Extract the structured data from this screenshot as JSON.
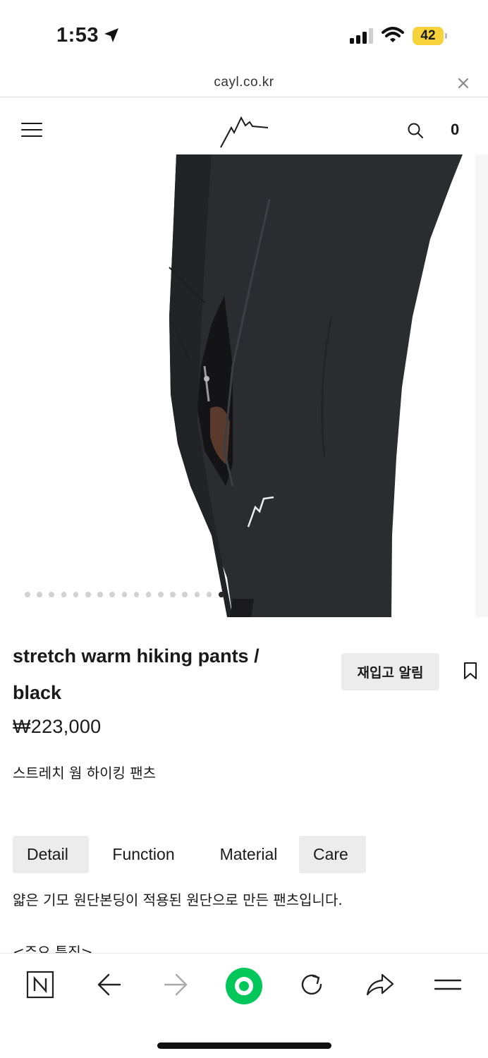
{
  "status_bar": {
    "time": "1:53",
    "battery_level": "42",
    "battery_color": "#f7d23b"
  },
  "browser": {
    "url": "cayl.co.kr",
    "close_icon": "close-icon"
  },
  "header": {
    "menu_icon": "hamburger-menu-icon",
    "logo_icon": "mountain-logo-icon",
    "search_icon": "search-icon",
    "cart_count": "0"
  },
  "gallery": {
    "total_slides": 17,
    "active_slide": 17
  },
  "product": {
    "title": "stretch warm hiking pants / black",
    "price": "₩223,000",
    "subtitle": "스트레치 웜 하이킹 팬츠",
    "restock_label": "재입고 알림",
    "bookmark_icon": "bookmark-icon"
  },
  "tabs": [
    {
      "label": "Detail",
      "highlighted": true
    },
    {
      "label": "Function",
      "highlighted": false
    },
    {
      "label": "Material",
      "highlighted": false
    },
    {
      "label": "Care",
      "highlighted": true
    }
  ],
  "content": {
    "description": "얇은 기모 원단본딩이 적용된 원단으로 만든 팬츠입니다.",
    "features_heading": "<주요 특징>"
  },
  "toolbar": {
    "items": [
      "naver-n-icon",
      "back-arrow-icon",
      "forward-arrow-icon",
      "green-circle-icon",
      "reload-icon",
      "share-icon",
      "menu-icon"
    ],
    "accent": "#03c75a"
  }
}
